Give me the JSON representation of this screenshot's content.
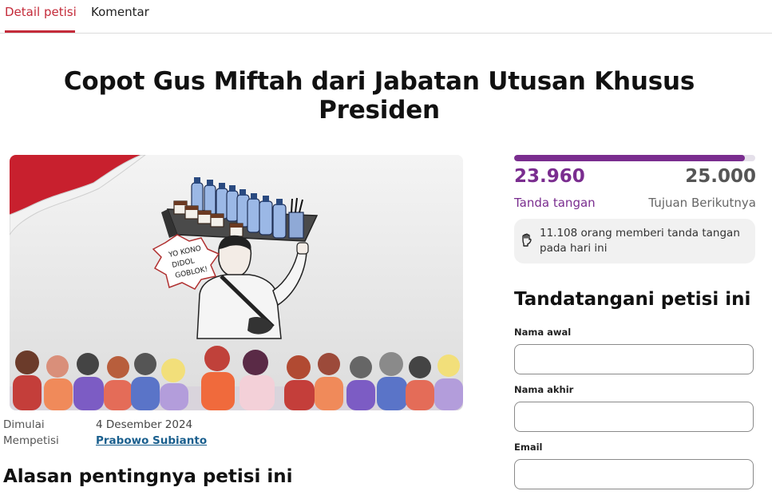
{
  "tabs": [
    {
      "label": "Detail petisi",
      "active": true
    },
    {
      "label": "Komentar",
      "active": false
    }
  ],
  "petition": {
    "title": "Copot Gus Miftah dari Jabatan Utusan Khusus Presiden",
    "image_speech_text": [
      "YO KONO",
      "DIDOL",
      "GOBLOK!"
    ]
  },
  "meta": {
    "started_label": "Dimulai",
    "started_value": "4 Desember 2024",
    "petitioning_label": "Mempetisi",
    "petitioning_value": "Prabowo Subianto"
  },
  "section_heading": "Alasan pentingnya petisi ini",
  "stats": {
    "signatures": "23.960",
    "signatures_label": "Tanda tangan",
    "goal": "25.000",
    "goal_label": "Tujuan Berikutnya",
    "progress_fraction": 0.958,
    "today_text": "11.108 orang memberi tanda tangan pada hari ini",
    "today_icon": "raised-fist-icon"
  },
  "form": {
    "heading": "Tandatangani petisi ini",
    "first_name_label": "Nama awal",
    "first_name_value": "",
    "last_name_label": "Nama akhir",
    "last_name_value": "",
    "email_label": "Email",
    "email_value": ""
  },
  "colors": {
    "tab_accent": "#c42b3a",
    "progress": "#7a2d8f",
    "link": "#1a5f8e"
  }
}
